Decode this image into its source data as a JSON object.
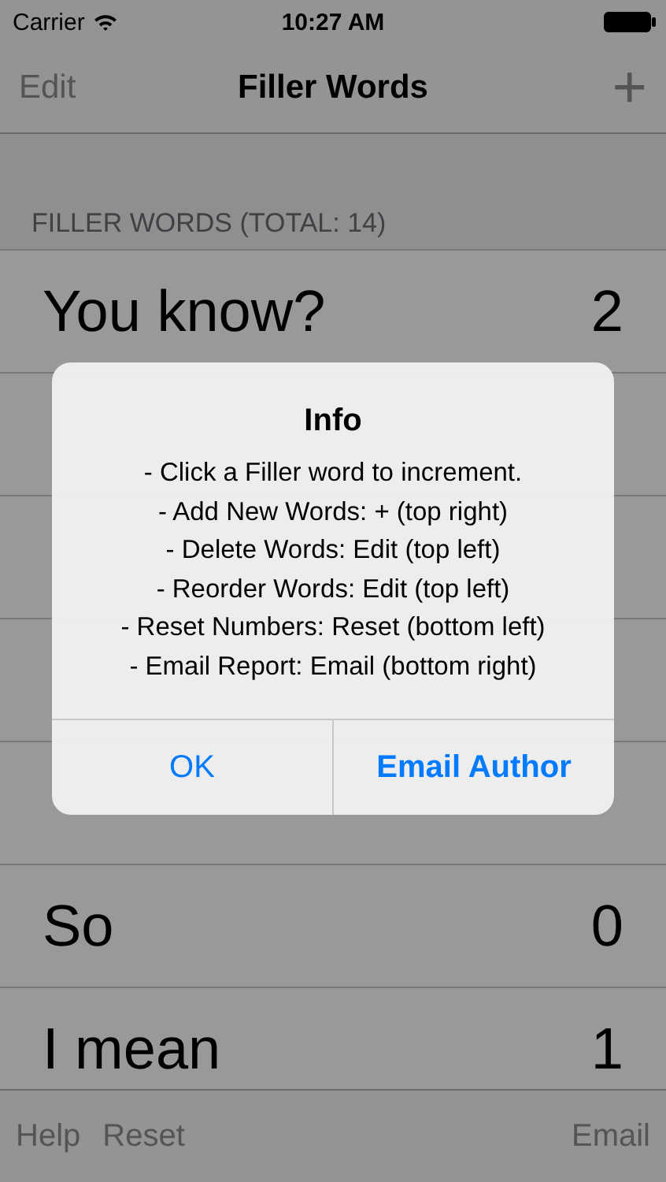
{
  "status_bar": {
    "carrier": "Carrier",
    "time": "10:27 AM"
  },
  "nav_bar": {
    "left": "Edit",
    "title": "Filler Words",
    "right": "+"
  },
  "section_header": "FILLER WORDS (TOTAL: 14)",
  "rows": [
    {
      "kind": "word",
      "word": "You know?",
      "count": "2"
    },
    {
      "kind": "hidden"
    },
    {
      "kind": "hidden"
    },
    {
      "kind": "hidden"
    },
    {
      "kind": "hidden"
    },
    {
      "kind": "word",
      "word": "So",
      "count": "0"
    },
    {
      "kind": "word",
      "word": "I mean",
      "count": "1"
    }
  ],
  "toolbar": {
    "left": [
      "Help",
      "Reset"
    ],
    "right": "Email"
  },
  "alert": {
    "title": "Info",
    "lines": [
      "- Click a Filler word to increment.",
      "- Add New Words: + (top right)",
      "- Delete Words: Edit (top left)",
      "- Reorder Words: Edit (top left)",
      "- Reset Numbers: Reset (bottom left)",
      "- Email Report: Email (bottom right)"
    ],
    "buttons": [
      {
        "label": "OK",
        "bold": false
      },
      {
        "label": "Email Author",
        "bold": true
      }
    ]
  }
}
